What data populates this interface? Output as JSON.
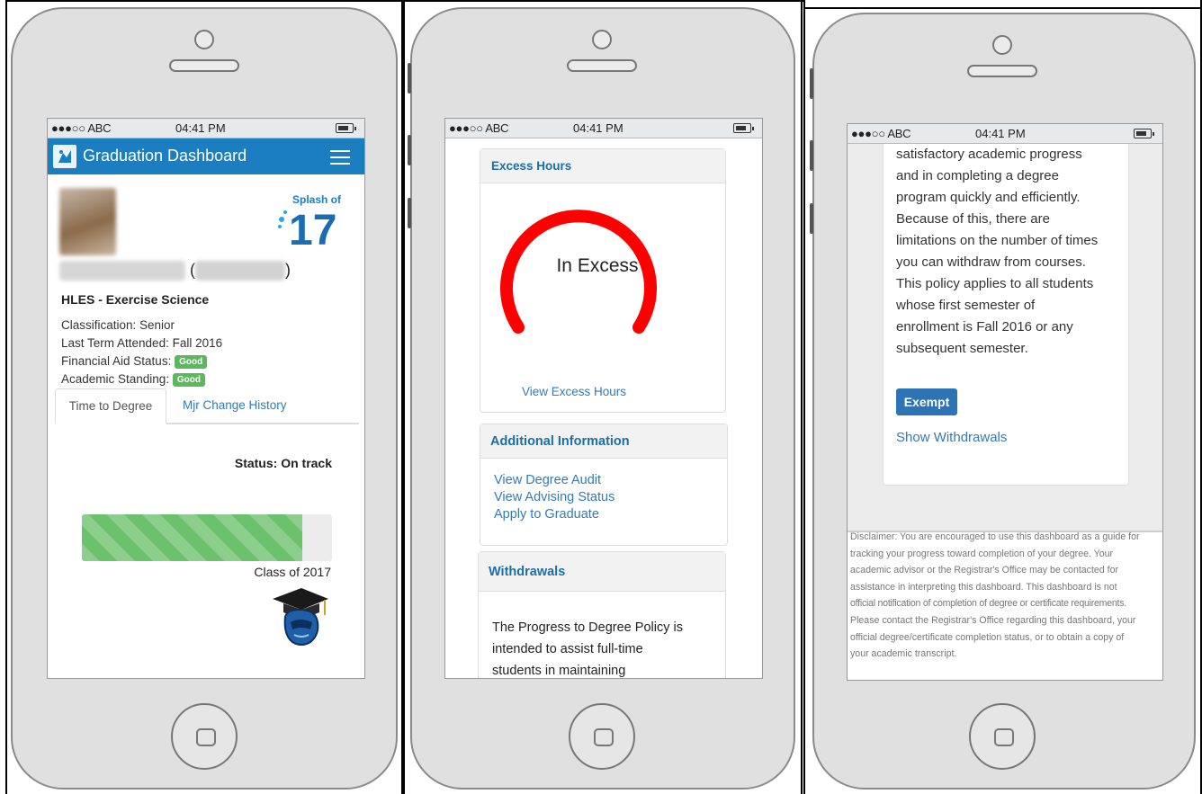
{
  "status_bar": {
    "carrier": "●●●○○ ABC",
    "time": "04:41 PM"
  },
  "panel1": {
    "header_title": "Graduation Dashboard",
    "major": "HLES - Exercise Science",
    "classification": "Classification: Senior",
    "last_term": "Last Term Attended: Fall 2016",
    "financial_aid_label": "Financial Aid Status:",
    "financial_aid_badge": "Good",
    "academic_standing_label": "Academic Standing:",
    "academic_standing_badge": "Good",
    "tabs": [
      "Time to Degree",
      "Mjr Change History"
    ],
    "status": "Status: On track",
    "progress_fraction": 0.88,
    "progress_label": "Class of 2017",
    "splash_logo_top": "Splash of",
    "splash_logo_num": "17",
    "colors": {
      "header": "#1b7ec1",
      "badge": "#5cb85c",
      "progress": "#6cc26c"
    }
  },
  "panel2": {
    "excess_title": "Excess Hours",
    "gauge_label": "In Excess",
    "view_excess_link": "View Excess Hours",
    "additional_title": "Additional Information",
    "additional_links": [
      "View Degree Audit",
      "View Advising Status",
      "Apply to Graduate"
    ],
    "withdrawals_title": "Withdrawals",
    "withdrawals_text_lines": [
      "The Progress to Degree Policy is",
      "intended to assist full-time",
      "students in maintaining"
    ],
    "colors": {
      "gauge": "#ff0000"
    }
  },
  "panel3": {
    "policy_lines": [
      "satisfactory academic progress",
      "and in completing a degree",
      "program quickly and efficiently.",
      "Because of this, there are",
      "limitations on the number of times",
      "you can withdraw from courses.",
      "This policy applies to all students",
      "whose first semester of",
      "enrollment is Fall 2016 or any",
      "subsequent semester."
    ],
    "exempt_button": "Exempt",
    "show_withdrawals": "Show Withdrawals",
    "disclaimer_lines": [
      "Disclaimer: You are encouraged to use this dashboard as a guide for",
      "tracking your progress toward completion of your degree. Your",
      "academic advisor or the Registrar's Office may be contacted for",
      "assistance in interpreting this dashboard. This dashboard is not",
      "official notification of completion of degree or certificate requirements.",
      "Please contact the Registrar's Office regarding this dashboard, your",
      "official degree/certificate completion status, or to obtain a copy of",
      "your academic transcript."
    ]
  }
}
